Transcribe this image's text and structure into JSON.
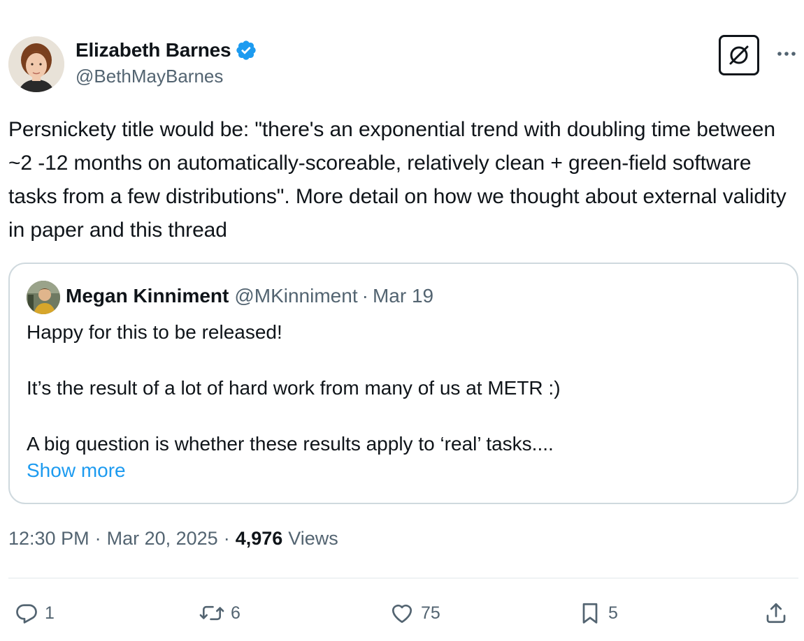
{
  "author": {
    "name": "Elizabeth Barnes",
    "handle": "@BethMayBarnes",
    "verified": true
  },
  "tweet": {
    "text": "Persnickety title would be: \"there's an exponential trend with doubling time between ~2 -12 months on automatically-scoreable, relatively clean + green-field software tasks from a few distributions\". More detail on how we thought about external validity in paper and this thread"
  },
  "quote": {
    "name": "Megan Kinniment",
    "handle": "@MKinniment",
    "separator": "·",
    "date": "Mar 19",
    "paragraphs": [
      "Happy for this to be released!",
      "It’s the result of a lot of hard work from many of us at METR :)",
      "A big question is whether these results apply to ‘real’ tasks...."
    ],
    "show_more": "Show more"
  },
  "meta": {
    "time": "12:30 PM",
    "date": "Mar 20, 2025",
    "separator": "·",
    "views_count": "4,976",
    "views_label": "Views"
  },
  "actions": {
    "reply_count": "1",
    "repost_count": "6",
    "like_count": "75",
    "bookmark_count": "5"
  },
  "icons": {
    "verified": "verified-badge-icon",
    "grok": "grok-icon",
    "more": "more-icon",
    "reply": "reply-icon",
    "repost": "repost-icon",
    "like": "heart-icon",
    "bookmark": "bookmark-icon",
    "share": "share-icon"
  },
  "colors": {
    "text": "#0f1419",
    "secondary": "#536471",
    "link": "#1d9bf0",
    "border": "#cfd9de",
    "verified": "#1d9bf0"
  }
}
